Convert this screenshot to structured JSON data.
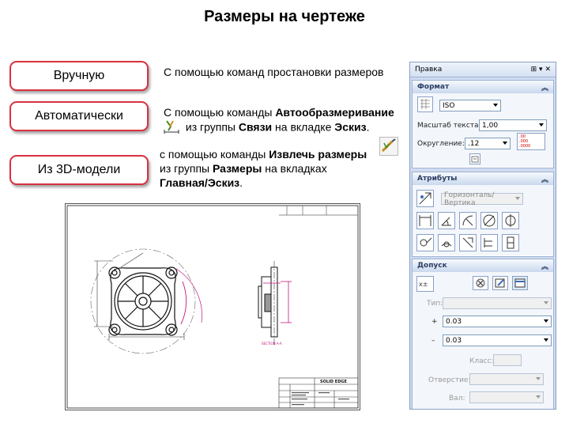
{
  "title": "Размеры на чертеже",
  "methods": [
    {
      "label": "Вручную"
    },
    {
      "label": "Автоматически"
    },
    {
      "label": "Из 3D-модели"
    }
  ],
  "descriptions": {
    "manual": "С помощью команд простановки размеров",
    "auto_line1_prefix": "С помощью команды ",
    "auto_line1_bold": "Автообразмеривание",
    "auto_line2_prefix": "из группы ",
    "auto_line2_group": "Связи",
    "auto_line2_mid": " на вкладке ",
    "auto_line2_tab": "Эскиз",
    "auto_line2_suffix": ".",
    "model_line1_prefix": "с помощью команды ",
    "model_line1_bold": "Извлечь размеры",
    "model_line2_prefix": "из группы ",
    "model_line2_group": "Размеры",
    "model_line2_suffix": " на вкладках",
    "model_line3_bold": "Главная/Эскиз",
    "model_line3_suffix": "."
  },
  "drawing": {
    "section_label": "SECTION A-A",
    "titleblock_brand": "SOLID EDGE",
    "icon": "technical-drawing"
  },
  "panel": {
    "header": "Правка",
    "format": {
      "title": "Формат",
      "standard": "ISO",
      "text_scale_label": "Масштаб текста:",
      "text_scale_value": "1,00",
      "rounding_label": "Округление:",
      "rounding_value": ".12",
      "round_opts": [
        ".00",
        ".000",
        ".0000"
      ]
    },
    "attributes": {
      "title": "Атрибуты",
      "orientation": "Горизонталь/Вертика"
    },
    "tolerance": {
      "title": "Допуск",
      "type_label": "Тип:",
      "type_value": "",
      "plus_sign": "+",
      "plus_value": "0.03",
      "minus_sign": "–",
      "minus_value": "0.03",
      "class_label": "Класс:",
      "class_value": "",
      "hole_label": "Отверстие:",
      "hole_value": "",
      "shaft_label": "Вал:",
      "shaft_value": ""
    }
  },
  "colors": {
    "accent_border": "#d9313f",
    "panel_bg": "#cfdcf0",
    "section_title": "#2b3d63"
  }
}
